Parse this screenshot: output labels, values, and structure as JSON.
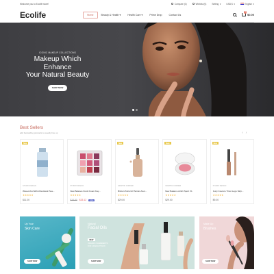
{
  "topbar": {
    "welcome": "Welcome you to Ecolife store!",
    "compare": "Compare (0)",
    "wishlist": "Wishlist (0)",
    "setting": "Setting",
    "currency": "USD $",
    "language": "English"
  },
  "header": {
    "logo": "Ecolife",
    "nav": [
      "Home",
      "Beauty & Health",
      "Health Care",
      "Prime Drop",
      "Contact Us"
    ],
    "cart_count": "0",
    "cart_total": "$0.00"
  },
  "hero": {
    "subtitle": "ICONIC MAKEUP COLLECTIONS",
    "title_line1": "Makeup Which Enhance",
    "title_line2": "Your Natural Beauty",
    "button": "SHOP NOW"
  },
  "best_sellers": {
    "title": "Best Sellers",
    "subtitle": "add bestselling products to weekly line up",
    "products": [
      {
        "badge": "New",
        "category": "STUDIO DESIGN",
        "name": "Waxed And Wrist Resistant Hea...",
        "stars": "★★★★★",
        "price": "$11.00",
        "old_price": "",
        "new_price": "",
        "discount": ""
      },
      {
        "badge": "",
        "category": "STUDIO DESIGN",
        "name": "New Balance Fresh Foam Kay...",
        "stars": "★★★★★",
        "price": "",
        "old_price": "$18.90",
        "new_price": "$15.12",
        "discount": "-20%"
      },
      {
        "badge": "New",
        "category": "GRAPHIC CORNER",
        "name": "Brixton Patrol All Terrain Anor...",
        "stars": "★★★★★",
        "price": "$29.00",
        "old_price": "",
        "new_price": "",
        "discount": ""
      },
      {
        "badge": "New",
        "category": "GRAPHIC CORNER",
        "name": "New Balance Arishi Sport V1",
        "stars": "★★★★★",
        "price": "$29.00",
        "old_price": "",
        "new_price": "",
        "discount": ""
      },
      {
        "badge": "New",
        "category": "STUDIO DESIGN",
        "name": "Juicy Couture Tricot Logo Strip...",
        "stars": "★★★★★",
        "price": "$9.00",
        "old_price": "",
        "new_price": "",
        "discount": ""
      }
    ]
  },
  "banners": {
    "b1": {
      "small": "Up Your",
      "big": "Skin Care",
      "button": "SHOP NOW"
    },
    "b2": {
      "small": "Natural",
      "big": "Facial Oils",
      "tag": "NEW",
      "desc1": "ORGANIC INGREDIENTS",
      "desc2": "FOR A RADIANT SKIN",
      "button": "SHOP NOW"
    },
    "b3": {
      "small": "Make Up",
      "big": "Brushes",
      "button": "SHOP NOW"
    }
  },
  "colors": {
    "accent": "#c56659",
    "star": "#f2b43b",
    "badge": "#e8c84c"
  }
}
